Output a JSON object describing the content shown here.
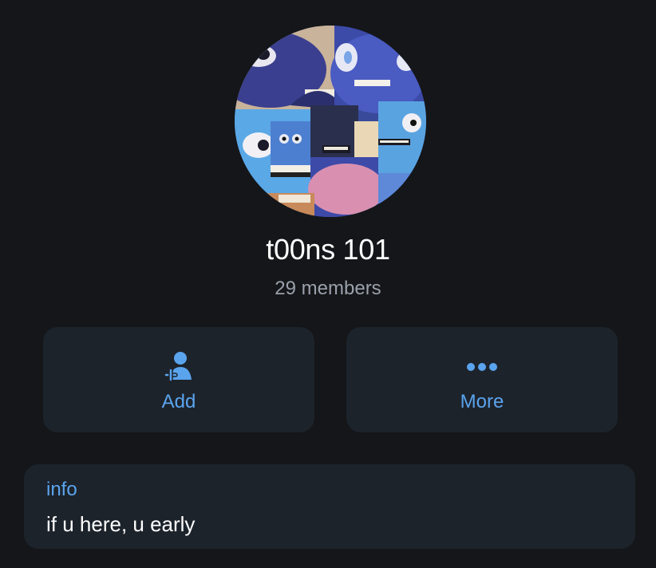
{
  "group": {
    "name": "t00ns 101",
    "members": "29 members"
  },
  "actions": {
    "add_label": "Add",
    "more_label": "More",
    "add_icon": "add-member-icon",
    "more_icon": "more-dots-icon"
  },
  "info": {
    "label": "info",
    "text": "if u here, u early"
  },
  "colors": {
    "background": "#141619",
    "card": "#1d232b",
    "accent": "#5aa4ee",
    "secondary_text": "#9aa1ab"
  }
}
